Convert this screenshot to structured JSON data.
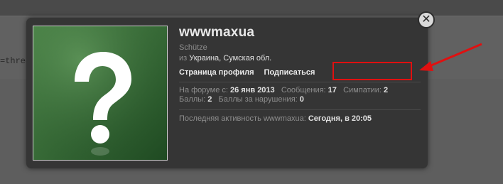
{
  "background": {
    "partial_text": "=threa"
  },
  "profile": {
    "username": "wwwmaxua",
    "user_title": "Schütze",
    "location_prefix": "из",
    "location": "Украина, Сумская обл.",
    "links": {
      "profile_page": "Страница профиля",
      "follow": "Подписаться"
    },
    "stats": {
      "joined_label": "На форуме с:",
      "joined_value": "26 янв 2013",
      "messages_label": "Сообщения:",
      "messages_value": "17",
      "likes_label": "Симпатии:",
      "likes_value": "2",
      "points_label": "Баллы:",
      "points_value": "2",
      "warning_points_label": "Баллы за нарушения:",
      "warning_points_value": "0"
    },
    "last_activity_label": "Последняя активность wwwmaxua:",
    "last_activity_value": "Сегодня, в 20:05"
  },
  "close_icon": "close-x",
  "annotation": {
    "highlight_color": "#e01010"
  }
}
